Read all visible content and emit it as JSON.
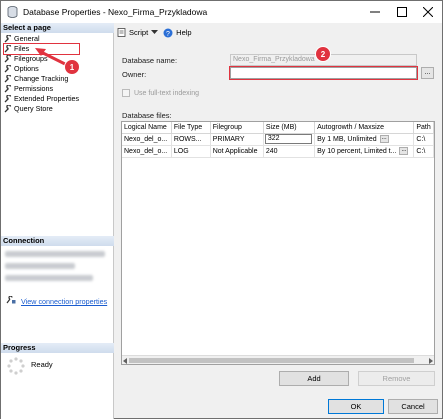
{
  "window": {
    "title": "Database Properties - Nexo_Firma_Przykladowa"
  },
  "left_panel": {
    "select_page_header": "Select a page",
    "pages": [
      {
        "label": "General"
      },
      {
        "label": "Files"
      },
      {
        "label": "Filegroups"
      },
      {
        "label": "Options"
      },
      {
        "label": "Change Tracking"
      },
      {
        "label": "Permissions"
      },
      {
        "label": "Extended Properties"
      },
      {
        "label": "Query Store"
      }
    ],
    "connection_header": "Connection",
    "view_connection_properties": "View connection properties",
    "progress_header": "Progress",
    "progress_status": "Ready"
  },
  "toolbar": {
    "script_label": "Script",
    "help_label": "Help"
  },
  "form": {
    "database_name_label": "Database name:",
    "database_name_value": "Nexo_Firma_Przykladowa",
    "owner_label": "Owner:",
    "owner_value": "",
    "fulltext_label": "Use full-text indexing",
    "database_files_label": "Database files:"
  },
  "files_grid": {
    "columns": [
      "Logical Name",
      "File Type",
      "Filegroup",
      "Size (MB)",
      "Autogrowth / Maxsize",
      "Path"
    ],
    "rows": [
      [
        "Nexo_del_o...",
        "ROWS...",
        "PRIMARY",
        "322",
        "By 1 MB, Unlimited",
        "C:\\"
      ],
      [
        "Nexo_del_o...",
        "LOG",
        "Not Applicable",
        "240",
        "By 10 percent, Limited t...",
        "C:\\"
      ]
    ]
  },
  "buttons": {
    "add": "Add",
    "remove": "Remove",
    "ok": "OK",
    "cancel": "Cancel",
    "ellipsis": "..."
  },
  "annotations": {
    "badge1": "1",
    "badge2": "2"
  },
  "colors": {
    "annotation_red": "#e0333f",
    "link_blue": "#1a5ccf"
  }
}
